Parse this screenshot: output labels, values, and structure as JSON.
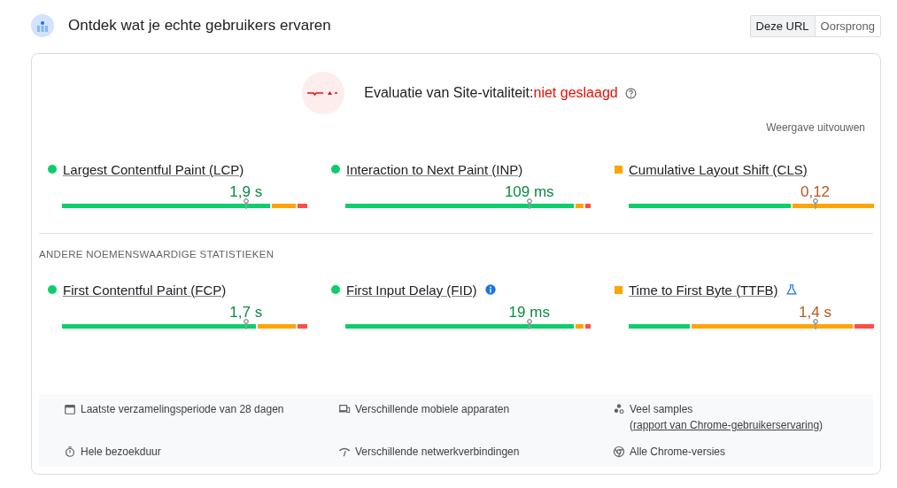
{
  "header": {
    "title": "Ontdek wat je echte gebruikers ervaren"
  },
  "scope_tabs": [
    {
      "label": "Deze URL",
      "selected": true
    },
    {
      "label": "Oorsprong",
      "selected": false
    }
  ],
  "assessment": {
    "label": "Evaluatie van Site-vitaliteit:",
    "result": "niet geslaagd",
    "kind": "failed",
    "expand_link": "Weergave uitvouwen"
  },
  "core_metrics": [
    {
      "name": "Largest Contentful Paint (LCP)",
      "kind": "good",
      "value": "1,9 s",
      "segments": [
        {
          "color": "#0cce6b",
          "level": 0.85
        },
        {
          "color": "#ffa400"
        },
        {
          "color": "#ff4e42",
          "level": 0.04
        }
      ]
    },
    {
      "name": "Interaction to Next Paint (INP)",
      "kind": "good",
      "value": "109 ms",
      "segments": [
        {
          "color": "#0cce6b",
          "level": 0.93
        },
        {
          "color": "#ffa400"
        },
        {
          "color": "#ff4e42",
          "level": 0.02
        }
      ]
    },
    {
      "name": "Cumulative Layout Shift (CLS)",
      "kind": "average",
      "value": "0,12",
      "segments": [
        {
          "color": "#0cce6b",
          "level": 0.66
        },
        {
          "color": "#ffa400"
        }
      ]
    }
  ],
  "other_section": {
    "heading": "ANDERE NOEMENSWAARDIGE STATISTIEKEN"
  },
  "other_metrics": [
    {
      "name": "First Contentful Paint (FCP)",
      "kind": "good",
      "value": "1,7 s",
      "segments": [
        {
          "color": "#0cce6b",
          "level": 0.79
        },
        {
          "color": "#ffa400"
        },
        {
          "color": "#ff4e42",
          "level": 0.04
        }
      ]
    },
    {
      "name": "First Input Delay (FID)",
      "kind": "good",
      "value": "19 ms",
      "info": true,
      "segments": [
        {
          "color": "#0cce6b",
          "level": 0.93
        },
        {
          "color": "#ffa400"
        },
        {
          "color": "#ff4e42",
          "level": 0.02
        }
      ]
    },
    {
      "name": "Time to First Byte (TTFB)",
      "kind": "average",
      "value": "1,4 s",
      "experimental": true,
      "segments": [
        {
          "color": "#0cce6b",
          "level": 0.25
        },
        {
          "color": "#ffa400"
        },
        {
          "color": "#ff4e42",
          "level": 0.08
        }
      ]
    }
  ],
  "details": [
    {
      "kind": "calendar",
      "text": "Laatste verzamelingsperiode van 28 dagen"
    },
    {
      "kind": "devices",
      "text": "Verschillende mobiele apparaten"
    },
    {
      "kind": "samples",
      "text": "Veel samples (",
      "link": "rapport van Chrome-gebruikerservaring",
      "after": ")"
    },
    {
      "kind": "timer",
      "text": "Hele bezoekduur"
    },
    {
      "kind": "network",
      "text": "Verschillende netwerkverbindingen"
    },
    {
      "kind": "chrome",
      "text": "Alle Chrome-versies"
    }
  ]
}
